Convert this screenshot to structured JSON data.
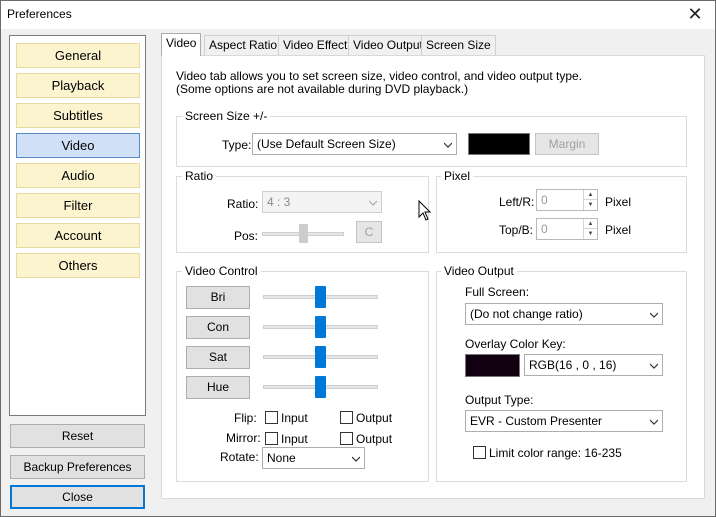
{
  "window": {
    "title": "Preferences",
    "close_glyph": "✕"
  },
  "categories": [
    "General",
    "Playback",
    "Subtitles",
    "Video",
    "Audio",
    "Filter",
    "Account",
    "Others"
  ],
  "selected_category": "Video",
  "left_buttons": {
    "reset": "Reset",
    "backup": "Backup Preferences",
    "close": "Close"
  },
  "tabs": [
    "Video",
    "Aspect Ratio",
    "Video Effect",
    "Video Output",
    "Screen Size"
  ],
  "active_tab": "Video",
  "description": {
    "line1": "Video tab allows you to set screen size, video control, and video output type.",
    "line2": "(Some options are not available during DVD playback.)"
  },
  "screen_size": {
    "group_label": "Screen Size +/-",
    "type_label": "Type:",
    "type_value": "(Use Default Screen Size)",
    "color_swatch": "#000000",
    "margin_label": "Margin"
  },
  "ratio": {
    "group_label": "Ratio",
    "ratio_label": "Ratio:",
    "ratio_value": "4 : 3",
    "pos_label": "Pos:",
    "c_label": "C"
  },
  "pixel": {
    "group_label": "Pixel",
    "left_label": "Left/R:",
    "left_value": "0",
    "top_label": "Top/B:",
    "top_value": "0",
    "unit": "Pixel"
  },
  "video_control": {
    "group_label": "Video Control",
    "sliders": [
      {
        "label": "Bri",
        "level": 0.5
      },
      {
        "label": "Con",
        "level": 0.5
      },
      {
        "label": "Sat",
        "level": 0.5
      },
      {
        "label": "Hue",
        "level": 0.5
      }
    ],
    "flip_label": "Flip:",
    "mirror_label": "Mirror:",
    "input_label": "Input",
    "output_label": "Output",
    "rotate_label": "Rotate:",
    "rotate_value": "None"
  },
  "video_output": {
    "group_label": "Video Output",
    "full_screen_label": "Full Screen:",
    "full_screen_value": "(Do not change ratio)",
    "overlay_label": "Overlay Color Key:",
    "overlay_swatch": "#100010",
    "overlay_value": "RGB(16 , 0 , 16)",
    "output_type_label": "Output Type:",
    "output_type_value": "EVR - Custom Presenter",
    "limit_label": "Limit color range: 16-235"
  },
  "colors": {
    "accent": "#0078d7",
    "category_bg": "#fcf3cf",
    "category_selected_bg": "#cfe0f7"
  }
}
